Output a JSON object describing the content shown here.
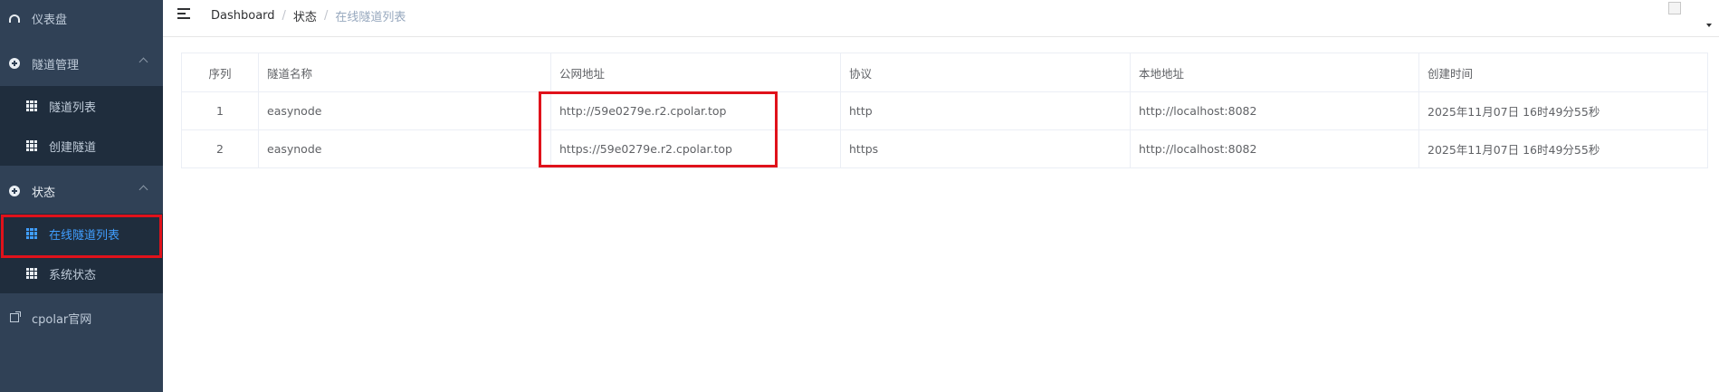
{
  "sidebar": {
    "dashboard": "仪表盘",
    "tunnel_management": "隧道管理",
    "tunnel_list": "隧道列表",
    "create_tunnel": "创建隧道",
    "status": "状态",
    "online_tunnel_list": "在线隧道列表",
    "system_status": "系统状态",
    "cpolar_site": "cpolar官网"
  },
  "breadcrumb": [
    "Dashboard",
    "状态",
    "在线隧道列表"
  ],
  "table": {
    "headers": [
      "序列",
      "隧道名称",
      "公网地址",
      "协议",
      "本地地址",
      "创建时间"
    ],
    "rows": [
      [
        "1",
        "easynode",
        "http://59e0279e.r2.cpolar.top",
        "http",
        "http://localhost:8082",
        "2025年11月07日 16时49分55秒"
      ],
      [
        "2",
        "easynode",
        "https://59e0279e.r2.cpolar.top",
        "https",
        "http://localhost:8082",
        "2025年11月07日 16时49分55秒"
      ]
    ]
  },
  "colors": {
    "sidebar_bg": "#304156",
    "submenu_bg": "#1f2d3d",
    "active": "#409eff",
    "highlight": "#e0121b"
  },
  "icons": [
    "dashboard-icon",
    "plus-circle-icon",
    "table-icon",
    "external-link-icon",
    "hamburger-icon",
    "avatar-image",
    "caret-down-icon"
  ]
}
